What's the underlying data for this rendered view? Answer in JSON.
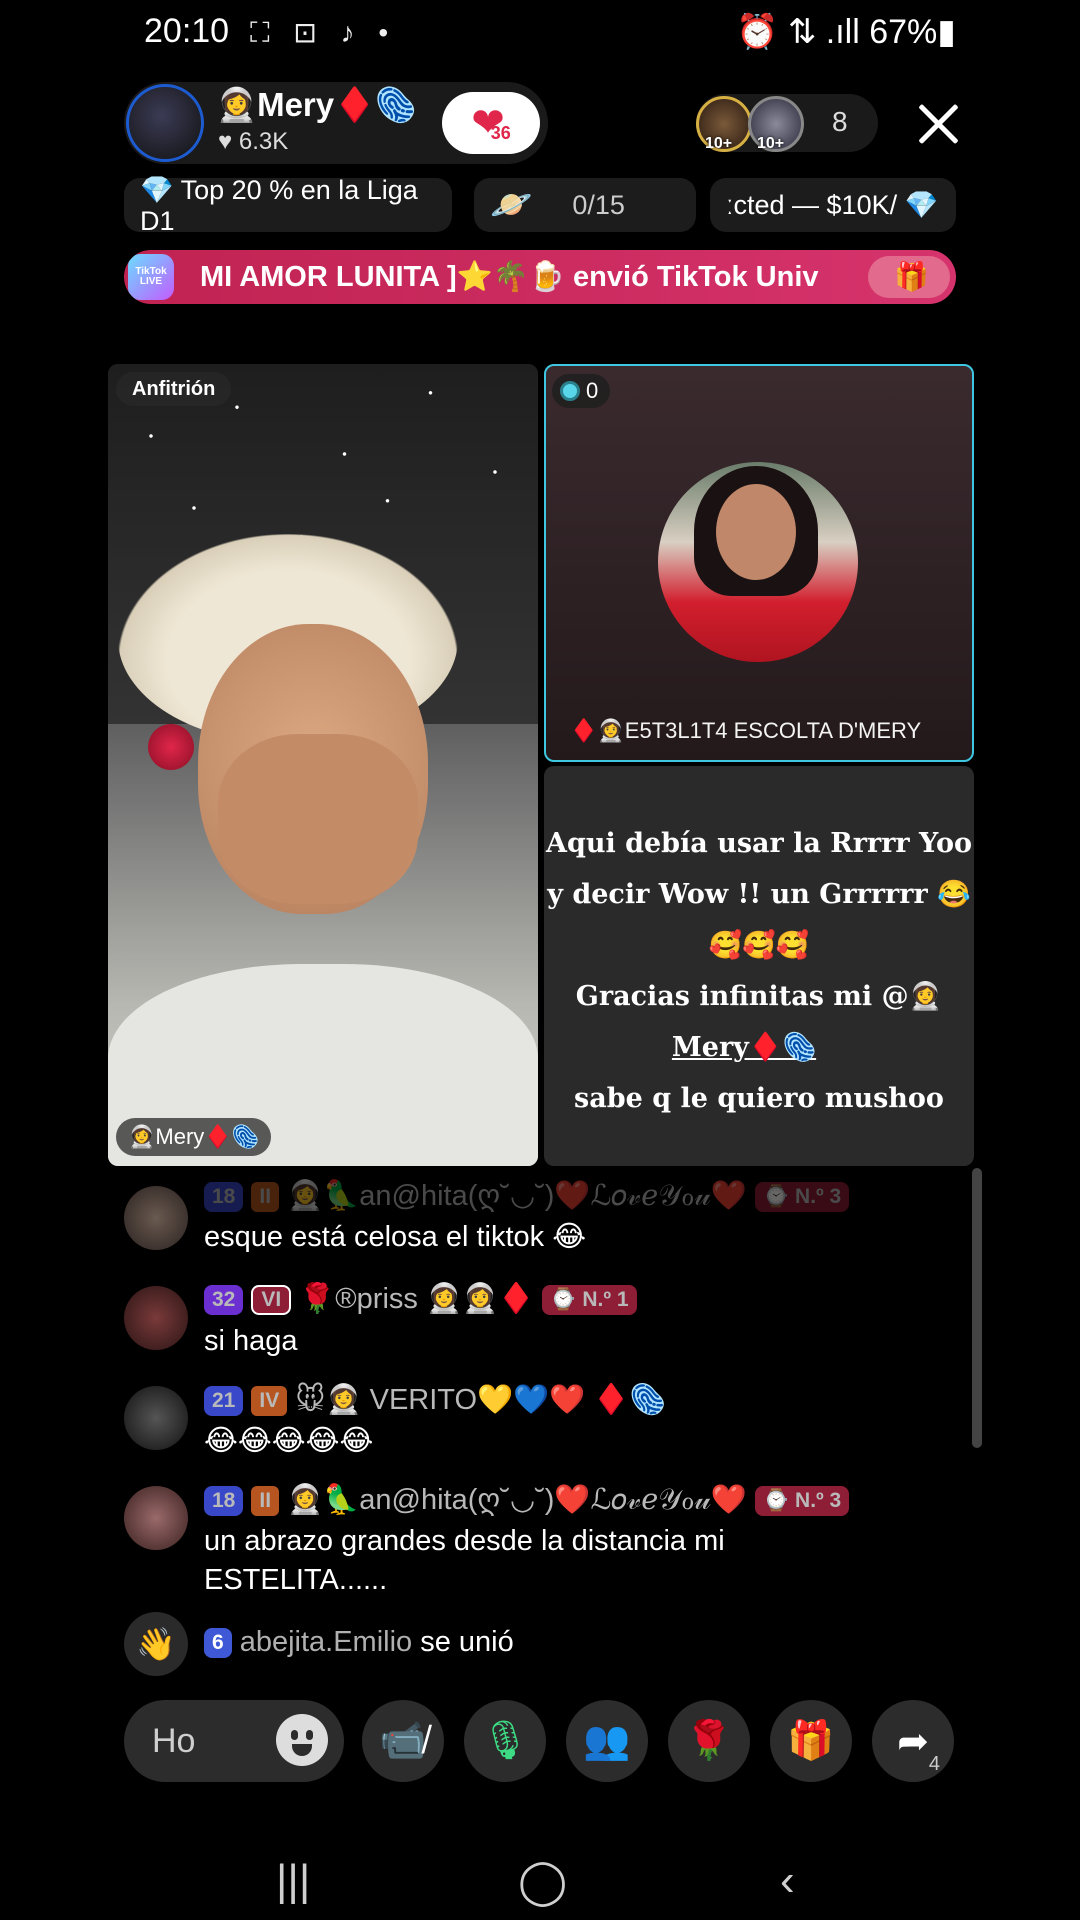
{
  "status_bar": {
    "time": "20:10",
    "icons": "⛶ ⊡ ♪ •",
    "right": "⏰ ⇅ .ıll 67%▮"
  },
  "host": {
    "name": "👩‍🚀Mery♦️🫆",
    "likes": "♥ 6.3K",
    "like_count": "36"
  },
  "viewers": {
    "badge1": "10+",
    "badge2": "10+",
    "count": "8"
  },
  "pills": {
    "league": "💎 Top 20 % en la Liga D1",
    "planet": "🪐",
    "planet_progress": "0/15",
    "collected": "ːcted — $10K/ 💎"
  },
  "banner": {
    "logo": "TikTok LIVE",
    "text": "MI AMOR LUNITA ]⭐🌴🍺 envió TikTok Univ",
    "gift_icon": "🎁"
  },
  "host_tile": {
    "tag": "Anfitrión",
    "name_tag": "👩‍🚀Mery♦️🫆"
  },
  "guest_tile": {
    "score": "0",
    "name": "♦️👩‍🚀E5T3L1T4 ESCOLTA D'MERY"
  },
  "message_tile": {
    "line1": "Aqui debía usar la Rrrrr Yoo",
    "line2": "y decir Wow !! un Grrrrrr 😂",
    "line3": "🥰🥰🥰",
    "line4": "Gracias infinitas mi @👩‍🚀",
    "line5": "Mery♦️🫆",
    "line6": "sabe q le quiero mushoo"
  },
  "chat": [
    {
      "level": "18",
      "rank": "II",
      "user": "👩‍🚀🦜an@hita(ღ˘◡˘)❤️ℒ𝑜𝓋ℯ𝒴ℴ𝓊❤️",
      "place": "⌚ N.º 3",
      "text": "esque está celosa el tiktok 😂"
    },
    {
      "level": "32",
      "rank": "VI",
      "user": "🌹®priss 👩‍🚀👩‍🚀♦️",
      "place": "⌚ N.º 1",
      "text": "si haga"
    },
    {
      "level": "21",
      "rank": "IV",
      "user": "🐭👩‍🚀 VERITO💛💙❤️ ♦️🫆",
      "place": "",
      "text": "😂😂😂😂😂"
    },
    {
      "level": "18",
      "rank": "II",
      "user": "👩‍🚀🦜an@hita(ღ˘◡˘)❤️ℒ𝑜𝓋ℯ𝒴ℴ𝓊❤️",
      "place": "⌚ N.º 3",
      "text": "un abrazo grandes desde la distancia mi ESTELITA......"
    }
  ],
  "join": {
    "level": "6",
    "user": "abejita.Emilio",
    "action": "se unió",
    "icon": "👋"
  },
  "bottom": {
    "placeholder": "Ho",
    "share_count": "4",
    "icons": {
      "video_off": "📹̸",
      "mic": "🎙",
      "guests": "👥",
      "rose": "🌹",
      "gift": "🎁",
      "share": "➦"
    }
  },
  "nav": {
    "recents": "|||",
    "home": "◯",
    "back": "‹"
  }
}
